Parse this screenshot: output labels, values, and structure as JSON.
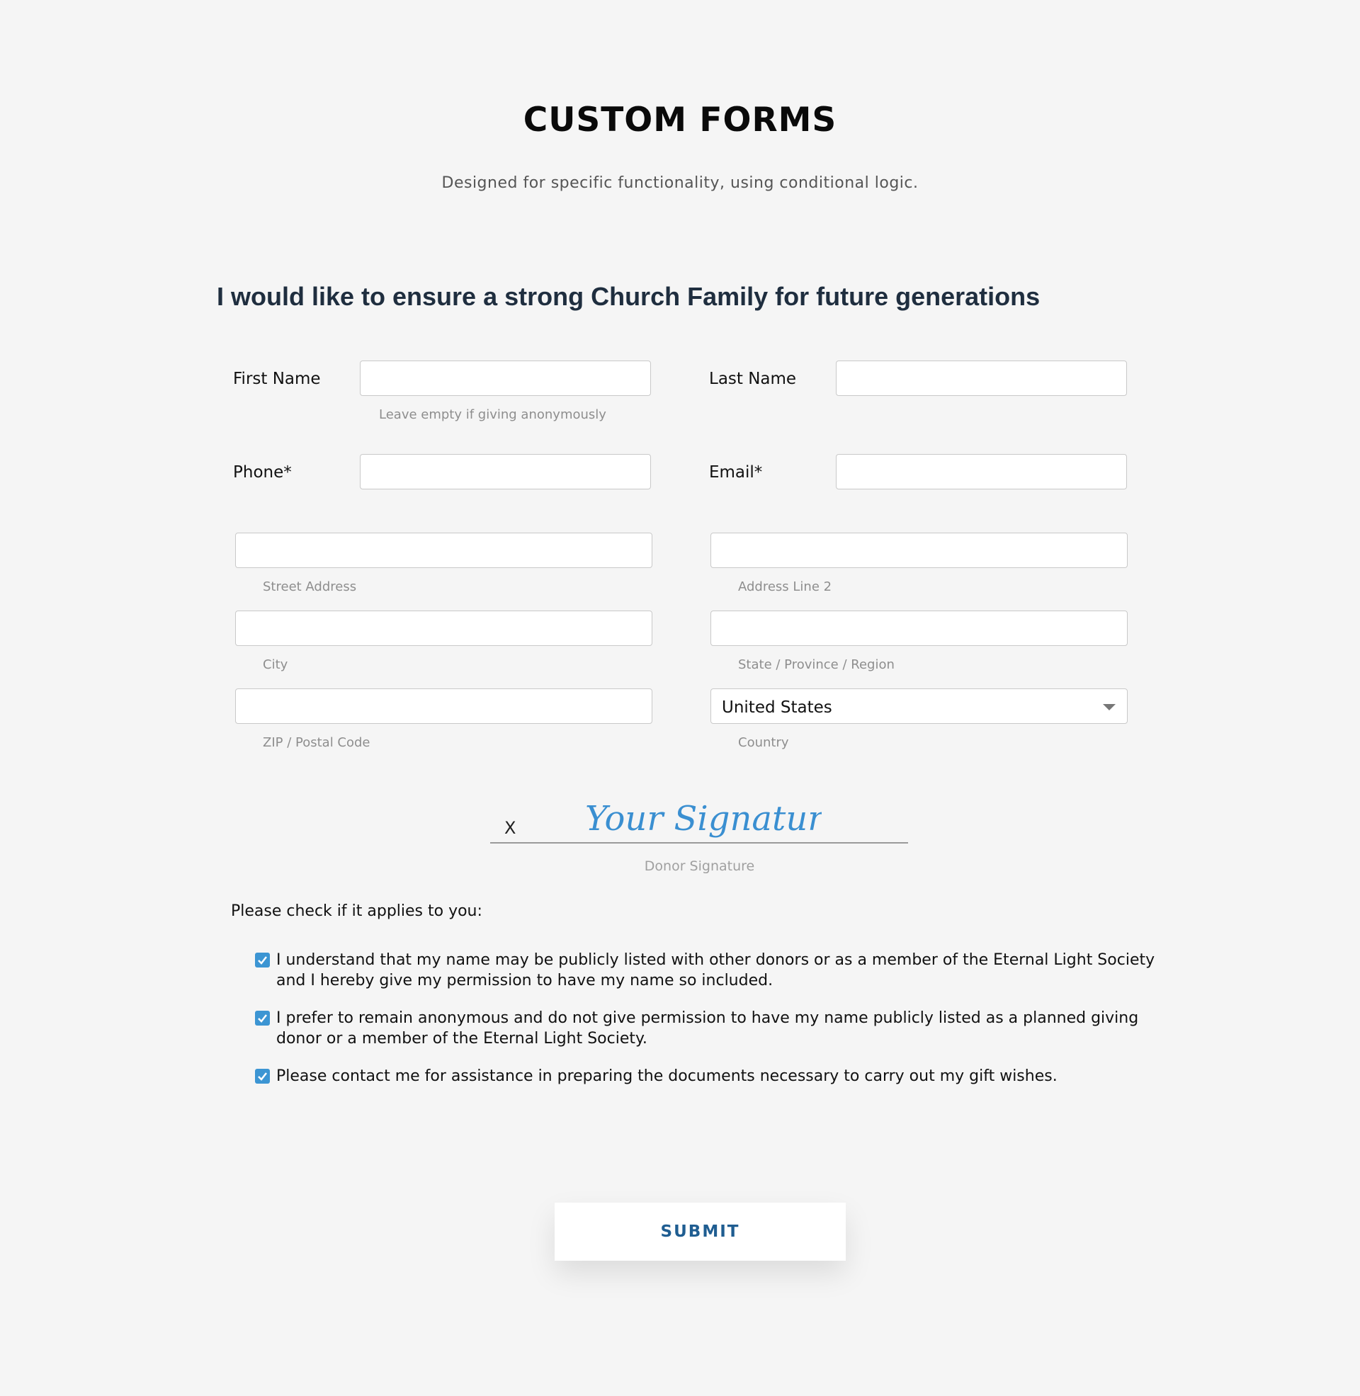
{
  "header": {
    "title": "CUSTOM FORMS",
    "subtitle": "Designed for specific functionality, using conditional logic."
  },
  "form": {
    "heading": "I would like to ensure a strong Church Family for future generations",
    "first_name": {
      "label": "First Name",
      "value": "",
      "hint": "Leave empty if giving anonymously"
    },
    "last_name": {
      "label": "Last Name",
      "value": ""
    },
    "phone": {
      "label": "Phone*",
      "value": ""
    },
    "email": {
      "label": "Email*",
      "value": ""
    },
    "address": {
      "street": {
        "value": "",
        "hint": "Street Address"
      },
      "line2": {
        "value": "",
        "hint": "Address Line 2"
      },
      "city": {
        "value": "",
        "hint": "City"
      },
      "state": {
        "value": "",
        "hint": "State / Province / Region"
      },
      "zip": {
        "value": "",
        "hint": "ZIP / Postal Code"
      },
      "country": {
        "value": "United States",
        "hint": "Country"
      }
    },
    "signature": {
      "x_mark": "X",
      "script_text": "Your Signature",
      "caption": "Donor Signature",
      "ink_color": "#3a8fd1"
    },
    "checks": {
      "prompt": "Please check if it applies to you:",
      "items": [
        {
          "text": "I understand that my name may be publicly listed with other donors or as a member of the Eternal Light Society and I hereby give my permission to have my name so included.",
          "checked": true
        },
        {
          "text": "I prefer to remain anonymous and do not give permission to have my name publicly listed as a planned giving donor or a member of the Eternal Light Society.",
          "checked": true
        },
        {
          "text": "Please contact me for assistance in preparing the documents necessary to carry out my gift wishes.",
          "checked": true
        }
      ]
    },
    "submit_label": "SUBMIT"
  },
  "colors": {
    "accent": "#3c95d3",
    "submit_text": "#1f5d91",
    "background": "#f5f5f5"
  }
}
